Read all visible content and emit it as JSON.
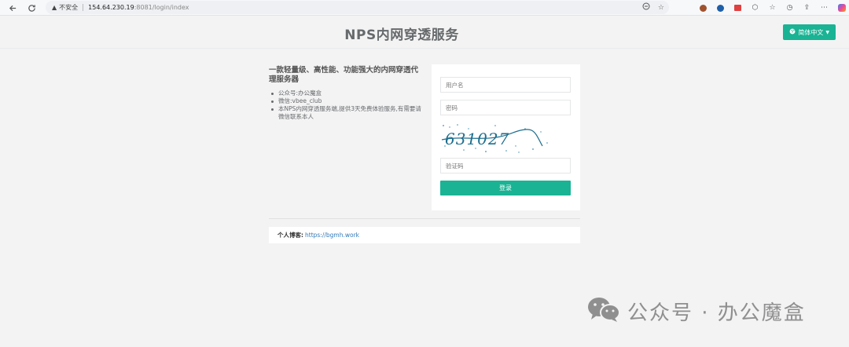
{
  "browser": {
    "security_label": "不安全",
    "url_host": "154.64.230.19",
    "url_rest": ":8081/login/index"
  },
  "header": {
    "title": "NPS内网穿透服务",
    "language_button": "简体中文"
  },
  "intro": {
    "heading": "一款轻量级、高性能、功能强大的内网穿透代理服务器",
    "items": [
      "公众号:办公魔盒",
      "微信:vbee_club",
      "本NPS内网穿透服务端,提供3天免费体验服务,有需要请微信联系本人"
    ]
  },
  "login": {
    "username_placeholder": "用户名",
    "password_placeholder": "密码",
    "captcha_placeholder": "验证码",
    "captcha_text": "631027",
    "submit_label": "登录"
  },
  "footer": {
    "blog_label": "个人博客:",
    "blog_link": "https://bgmh.work"
  },
  "watermark": {
    "text": "公众号 · 办公魔盒"
  },
  "colors": {
    "accent": "#1ab394",
    "link": "#337ab7",
    "background": "#f3f3f4"
  }
}
